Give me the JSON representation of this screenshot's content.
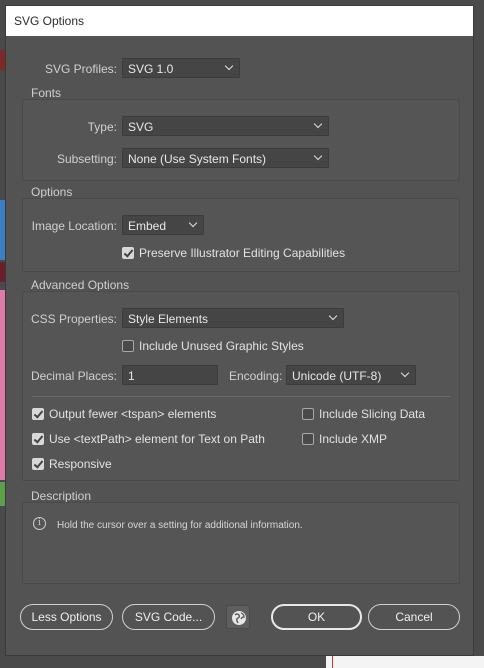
{
  "colors": {
    "dialog_bg": "#535353",
    "titlebar_bg": "#ffffff",
    "field_bg": "#454545"
  },
  "dialog": {
    "title": "SVG Options"
  },
  "profiles": {
    "label": "SVG Profiles:",
    "value": "SVG 1.0"
  },
  "fonts": {
    "title": "Fonts",
    "type_label": "Type:",
    "type_value": "SVG",
    "subsetting_label": "Subsetting:",
    "subsetting_value": "None (Use System Fonts)"
  },
  "options": {
    "title": "Options",
    "image_location_label": "Image Location:",
    "image_location_value": "Embed",
    "preserve_label": "Preserve Illustrator Editing Capabilities",
    "preserve_checked": true
  },
  "advanced": {
    "title": "Advanced Options",
    "css_label": "CSS Properties:",
    "css_value": "Style Elements",
    "unused_label": "Include Unused Graphic Styles",
    "unused_checked": false,
    "decimal_label": "Decimal Places:",
    "decimal_value": "1",
    "encoding_label": "Encoding:",
    "encoding_value": "Unicode (UTF-8)",
    "tspan_label": "Output fewer <tspan> elements",
    "tspan_checked": true,
    "textpath_label": "Use <textPath> element for Text on Path",
    "textpath_checked": true,
    "responsive_label": "Responsive",
    "responsive_checked": true,
    "slicing_label": "Include Slicing Data",
    "slicing_checked": false,
    "xmp_label": "Include XMP",
    "xmp_checked": false
  },
  "description": {
    "title": "Description",
    "text": "Hold the cursor over a setting for additional information.",
    "icon": "info-icon"
  },
  "buttons": {
    "less_options": "Less Options",
    "svg_code": "SVG Code...",
    "web_icon": "globe-icon",
    "ok": "OK",
    "cancel": "Cancel"
  }
}
